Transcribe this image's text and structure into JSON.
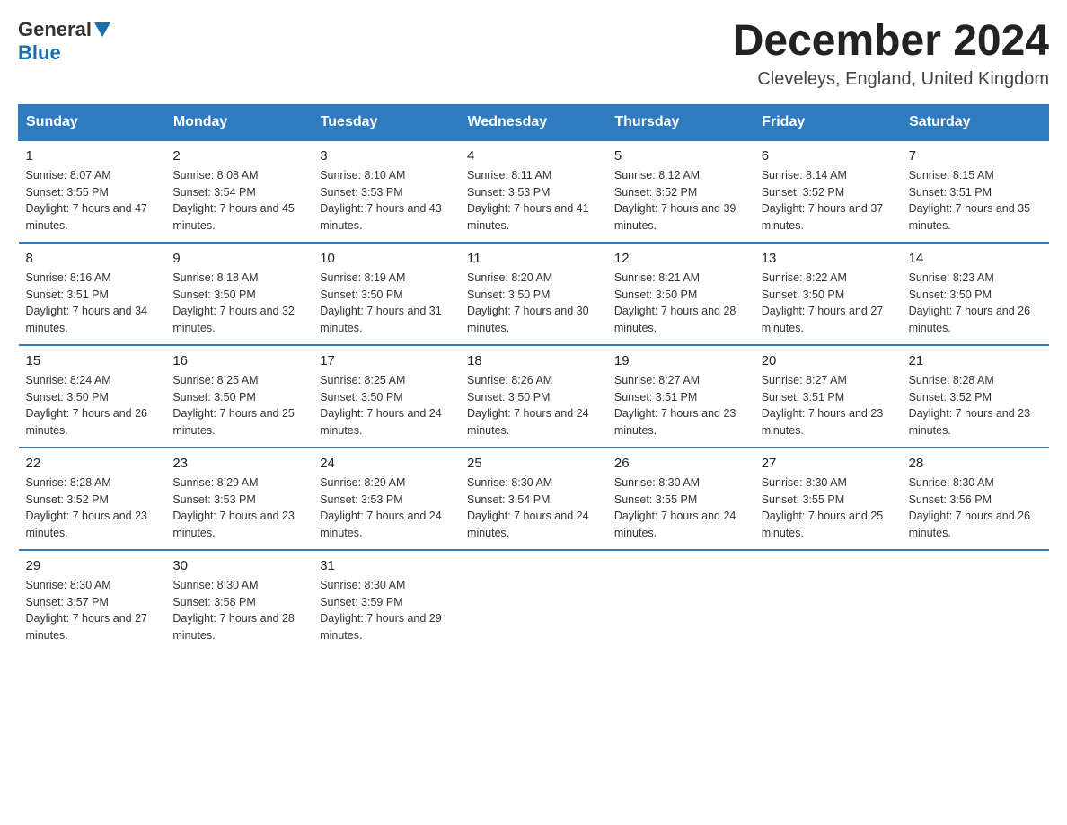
{
  "logo": {
    "general": "General",
    "blue": "Blue"
  },
  "title": "December 2024",
  "location": "Cleveleys, England, United Kingdom",
  "days_of_week": [
    "Sunday",
    "Monday",
    "Tuesday",
    "Wednesday",
    "Thursday",
    "Friday",
    "Saturday"
  ],
  "weeks": [
    [
      {
        "day": "1",
        "sunrise": "8:07 AM",
        "sunset": "3:55 PM",
        "daylight": "7 hours and 47 minutes."
      },
      {
        "day": "2",
        "sunrise": "8:08 AM",
        "sunset": "3:54 PM",
        "daylight": "7 hours and 45 minutes."
      },
      {
        "day": "3",
        "sunrise": "8:10 AM",
        "sunset": "3:53 PM",
        "daylight": "7 hours and 43 minutes."
      },
      {
        "day": "4",
        "sunrise": "8:11 AM",
        "sunset": "3:53 PM",
        "daylight": "7 hours and 41 minutes."
      },
      {
        "day": "5",
        "sunrise": "8:12 AM",
        "sunset": "3:52 PM",
        "daylight": "7 hours and 39 minutes."
      },
      {
        "day": "6",
        "sunrise": "8:14 AM",
        "sunset": "3:52 PM",
        "daylight": "7 hours and 37 minutes."
      },
      {
        "day": "7",
        "sunrise": "8:15 AM",
        "sunset": "3:51 PM",
        "daylight": "7 hours and 35 minutes."
      }
    ],
    [
      {
        "day": "8",
        "sunrise": "8:16 AM",
        "sunset": "3:51 PM",
        "daylight": "7 hours and 34 minutes."
      },
      {
        "day": "9",
        "sunrise": "8:18 AM",
        "sunset": "3:50 PM",
        "daylight": "7 hours and 32 minutes."
      },
      {
        "day": "10",
        "sunrise": "8:19 AM",
        "sunset": "3:50 PM",
        "daylight": "7 hours and 31 minutes."
      },
      {
        "day": "11",
        "sunrise": "8:20 AM",
        "sunset": "3:50 PM",
        "daylight": "7 hours and 30 minutes."
      },
      {
        "day": "12",
        "sunrise": "8:21 AM",
        "sunset": "3:50 PM",
        "daylight": "7 hours and 28 minutes."
      },
      {
        "day": "13",
        "sunrise": "8:22 AM",
        "sunset": "3:50 PM",
        "daylight": "7 hours and 27 minutes."
      },
      {
        "day": "14",
        "sunrise": "8:23 AM",
        "sunset": "3:50 PM",
        "daylight": "7 hours and 26 minutes."
      }
    ],
    [
      {
        "day": "15",
        "sunrise": "8:24 AM",
        "sunset": "3:50 PM",
        "daylight": "7 hours and 26 minutes."
      },
      {
        "day": "16",
        "sunrise": "8:25 AM",
        "sunset": "3:50 PM",
        "daylight": "7 hours and 25 minutes."
      },
      {
        "day": "17",
        "sunrise": "8:25 AM",
        "sunset": "3:50 PM",
        "daylight": "7 hours and 24 minutes."
      },
      {
        "day": "18",
        "sunrise": "8:26 AM",
        "sunset": "3:50 PM",
        "daylight": "7 hours and 24 minutes."
      },
      {
        "day": "19",
        "sunrise": "8:27 AM",
        "sunset": "3:51 PM",
        "daylight": "7 hours and 23 minutes."
      },
      {
        "day": "20",
        "sunrise": "8:27 AM",
        "sunset": "3:51 PM",
        "daylight": "7 hours and 23 minutes."
      },
      {
        "day": "21",
        "sunrise": "8:28 AM",
        "sunset": "3:52 PM",
        "daylight": "7 hours and 23 minutes."
      }
    ],
    [
      {
        "day": "22",
        "sunrise": "8:28 AM",
        "sunset": "3:52 PM",
        "daylight": "7 hours and 23 minutes."
      },
      {
        "day": "23",
        "sunrise": "8:29 AM",
        "sunset": "3:53 PM",
        "daylight": "7 hours and 23 minutes."
      },
      {
        "day": "24",
        "sunrise": "8:29 AM",
        "sunset": "3:53 PM",
        "daylight": "7 hours and 24 minutes."
      },
      {
        "day": "25",
        "sunrise": "8:30 AM",
        "sunset": "3:54 PM",
        "daylight": "7 hours and 24 minutes."
      },
      {
        "day": "26",
        "sunrise": "8:30 AM",
        "sunset": "3:55 PM",
        "daylight": "7 hours and 24 minutes."
      },
      {
        "day": "27",
        "sunrise": "8:30 AM",
        "sunset": "3:55 PM",
        "daylight": "7 hours and 25 minutes."
      },
      {
        "day": "28",
        "sunrise": "8:30 AM",
        "sunset": "3:56 PM",
        "daylight": "7 hours and 26 minutes."
      }
    ],
    [
      {
        "day": "29",
        "sunrise": "8:30 AM",
        "sunset": "3:57 PM",
        "daylight": "7 hours and 27 minutes."
      },
      {
        "day": "30",
        "sunrise": "8:30 AM",
        "sunset": "3:58 PM",
        "daylight": "7 hours and 28 minutes."
      },
      {
        "day": "31",
        "sunrise": "8:30 AM",
        "sunset": "3:59 PM",
        "daylight": "7 hours and 29 minutes."
      },
      null,
      null,
      null,
      null
    ]
  ]
}
